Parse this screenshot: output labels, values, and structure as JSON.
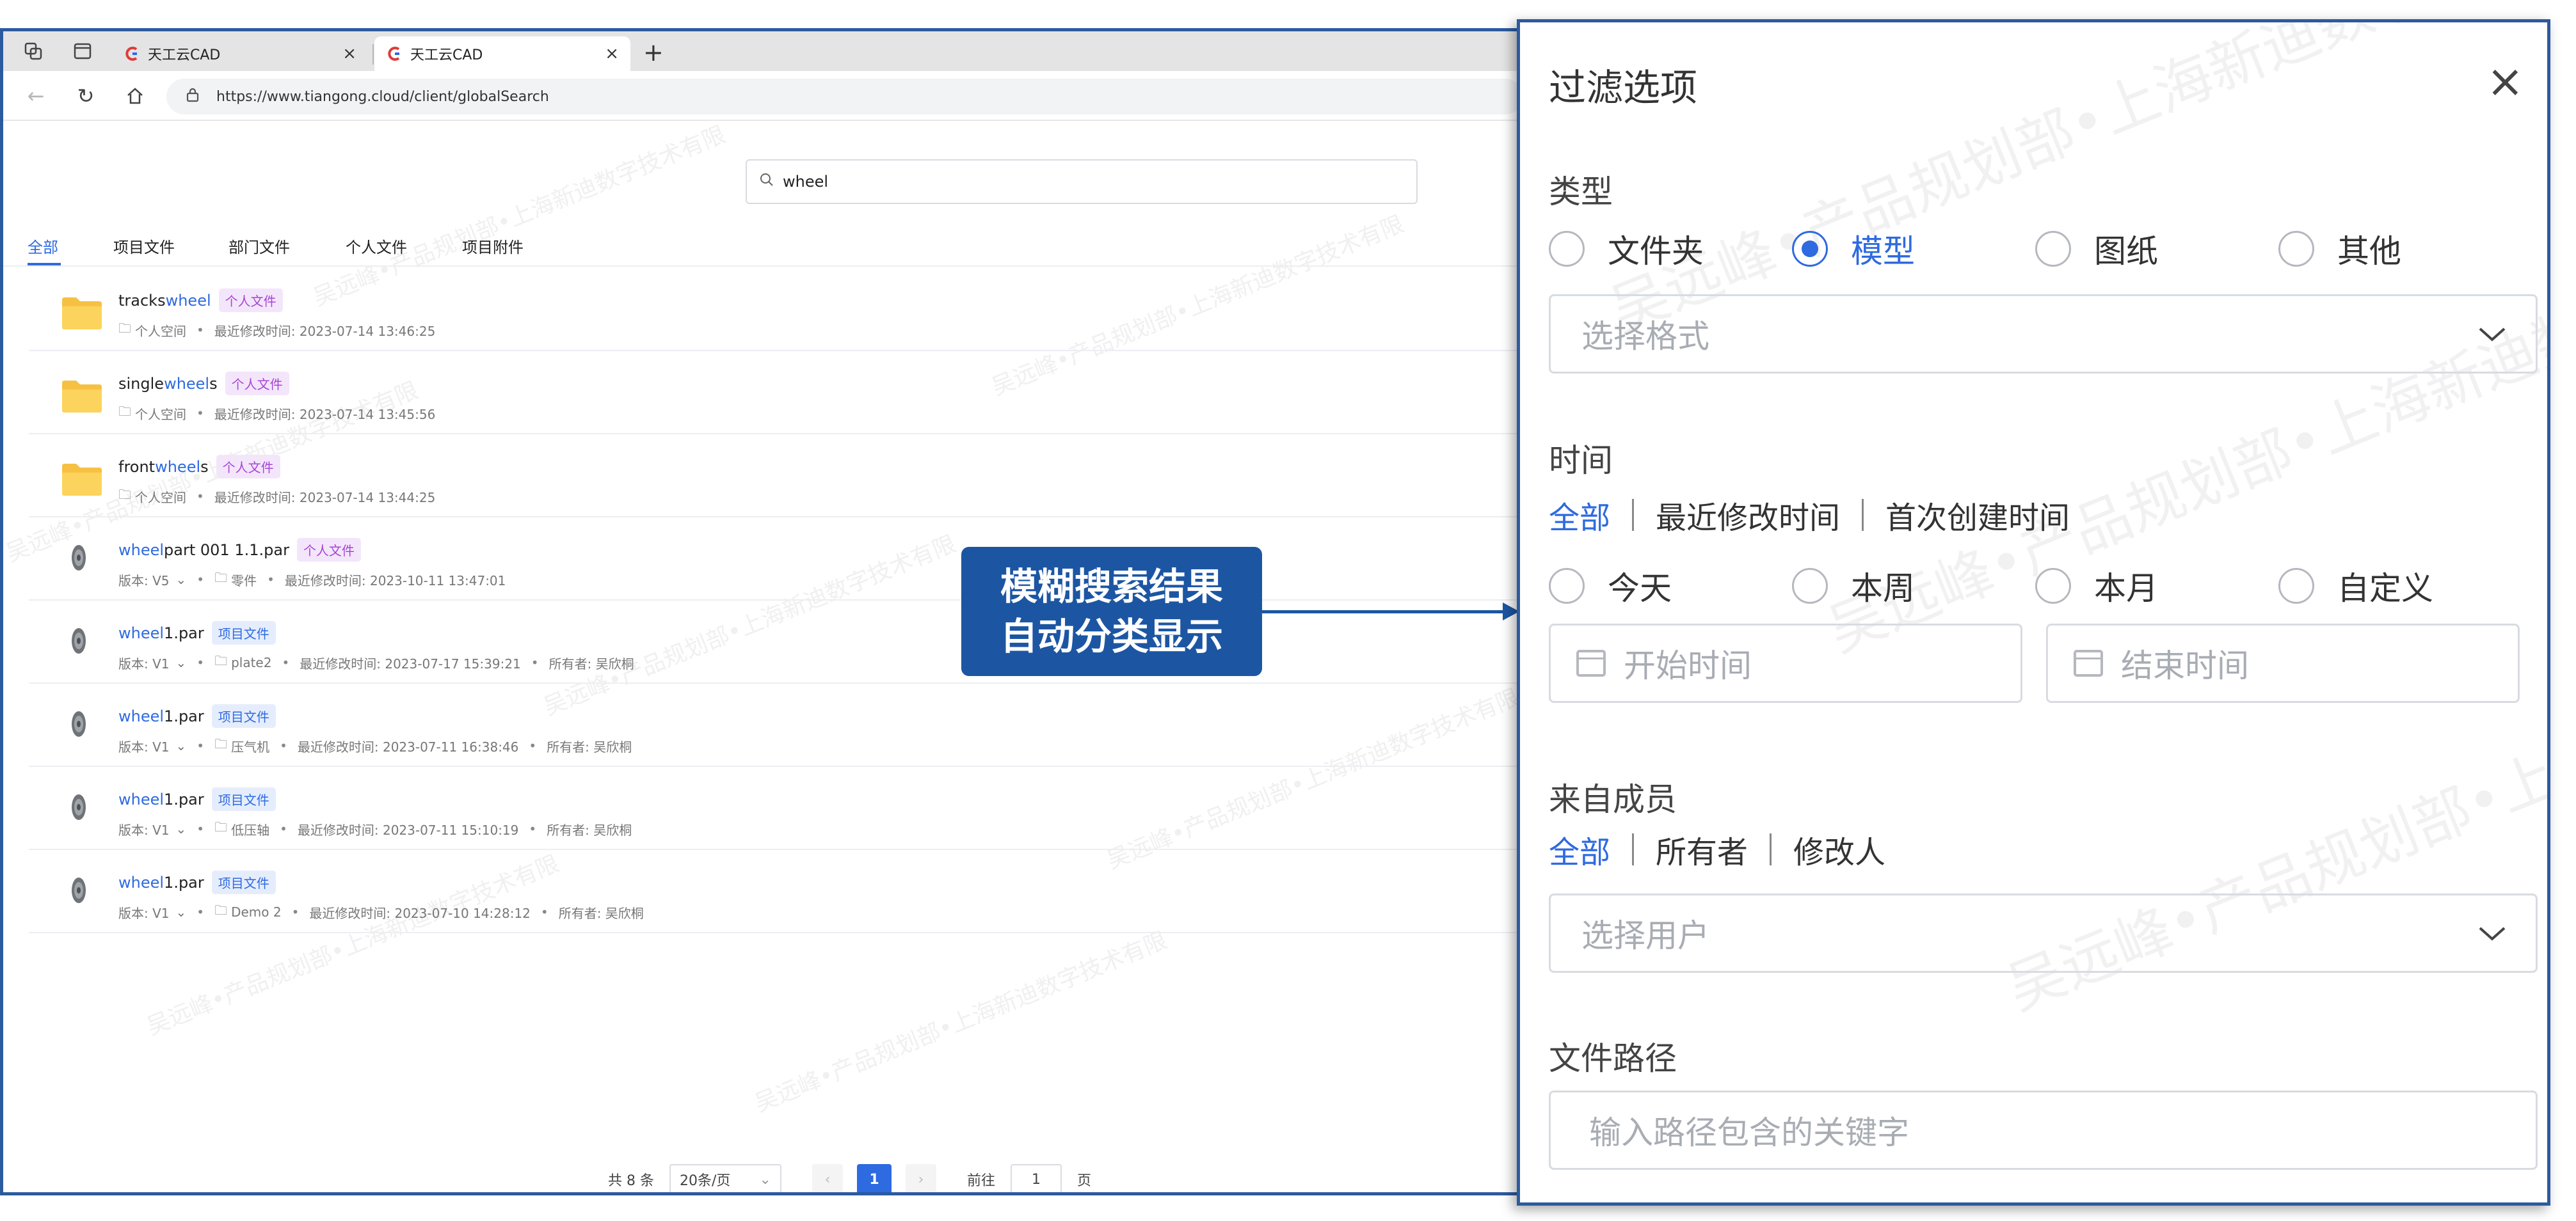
{
  "browser": {
    "tabs": [
      {
        "title": "天工云CAD",
        "close": "×"
      },
      {
        "title": "天工云CAD",
        "close": "×"
      }
    ],
    "new_tab": "+",
    "url": "https://www.tiangong.cloud/client/globalSearch"
  },
  "search": {
    "value": "wheel"
  },
  "category_tabs": [
    "全部",
    "项目文件",
    "部门文件",
    "个人文件",
    "项目附件"
  ],
  "results": [
    {
      "type": "folder",
      "prefix": "tracks ",
      "match": "wheel",
      "suffix": "",
      "badge": "个人文件",
      "badge_kind": "personal",
      "location": "个人空间",
      "modified": "最近修改时间: 2023-07-14 13:46:25"
    },
    {
      "type": "folder",
      "prefix": "single ",
      "match": "wheel",
      "suffix": "s",
      "badge": "个人文件",
      "badge_kind": "personal",
      "location": "个人空间",
      "modified": "最近修改时间: 2023-07-14 13:45:56"
    },
    {
      "type": "folder",
      "prefix": "front ",
      "match": "wheel",
      "suffix": "s",
      "badge": "个人文件",
      "badge_kind": "personal",
      "location": "个人空间",
      "modified": "最近修改时间: 2023-07-14 13:44:25"
    },
    {
      "type": "part",
      "prefix": "",
      "match": "wheel",
      "suffix": " part 001 1.1.par",
      "badge": "个人文件",
      "badge_kind": "personal",
      "version": "版本: V5",
      "location": "零件",
      "modified": "最近修改时间: 2023-10-11 13:47:01",
      "owner": ""
    },
    {
      "type": "part",
      "prefix": "",
      "match": "wheel",
      "suffix": "1.par",
      "badge": "项目文件",
      "badge_kind": "project",
      "version": "版本: V1",
      "location": "plate2",
      "modified": "最近修改时间: 2023-07-17 15:39:21",
      "owner": "所有者: 吴欣桐"
    },
    {
      "type": "part",
      "prefix": "",
      "match": "wheel",
      "suffix": "1.par",
      "badge": "项目文件",
      "badge_kind": "project",
      "version": "版本: V1",
      "location": "压气机",
      "modified": "最近修改时间: 2023-07-11 16:38:46",
      "owner": "所有者: 吴欣桐"
    },
    {
      "type": "part",
      "prefix": "",
      "match": "wheel",
      "suffix": "1.par",
      "badge": "项目文件",
      "badge_kind": "project",
      "version": "版本: V1",
      "location": "低压轴",
      "modified": "最近修改时间: 2023-07-11 15:10:19",
      "owner": "所有者: 吴欣桐"
    },
    {
      "type": "part",
      "prefix": "",
      "match": "wheel",
      "suffix": "1.par",
      "badge": "项目文件",
      "badge_kind": "project",
      "version": "版本: V1",
      "location": "Demo 2",
      "modified": "最近修改时间: 2023-07-10 14:28:12",
      "owner": "所有者: 吴欣桐"
    }
  ],
  "pager": {
    "total": "共 8 条",
    "page_size": "20条/页",
    "current": "1",
    "jump_label": "前往",
    "jump_value": "1",
    "page_unit": "页"
  },
  "callout": {
    "line1": "模糊搜索结果",
    "line2": "自动分类显示"
  },
  "filter": {
    "title": "过滤选项",
    "close": "×",
    "type_label": "类型",
    "type_options": [
      "文件夹",
      "模型",
      "图纸",
      "其他"
    ],
    "type_selected": "模型",
    "format_placeholder": "选择格式",
    "time_label": "时间",
    "time_modes": [
      "全部",
      "最近修改时间",
      "首次创建时间"
    ],
    "time_ranges": [
      "今天",
      "本周",
      "本月",
      "自定义"
    ],
    "start_placeholder": "开始时间",
    "end_placeholder": "结束时间",
    "member_label": "来自成员",
    "member_modes": [
      "全部",
      "所有者",
      "修改人"
    ],
    "user_placeholder": "选择用户",
    "path_label": "文件路径",
    "path_placeholder": "输入路径包含的关键字"
  },
  "watermark": "吴远峰•产品规划部•上海新迪数字技术有限",
  "colors": {
    "accent": "#2e6ae0",
    "callout": "#1c56a3",
    "frame": "#2c5a9e",
    "personal_badge": "#a844d6"
  },
  "icons": [
    "workspaces-icon",
    "tab-list-icon",
    "tiangong-logo-icon",
    "back-icon",
    "reload-icon",
    "home-icon",
    "lock-icon",
    "search-icon",
    "folder-icon",
    "part-disc-icon",
    "close-icon",
    "chevron-down-icon",
    "calendar-icon"
  ]
}
